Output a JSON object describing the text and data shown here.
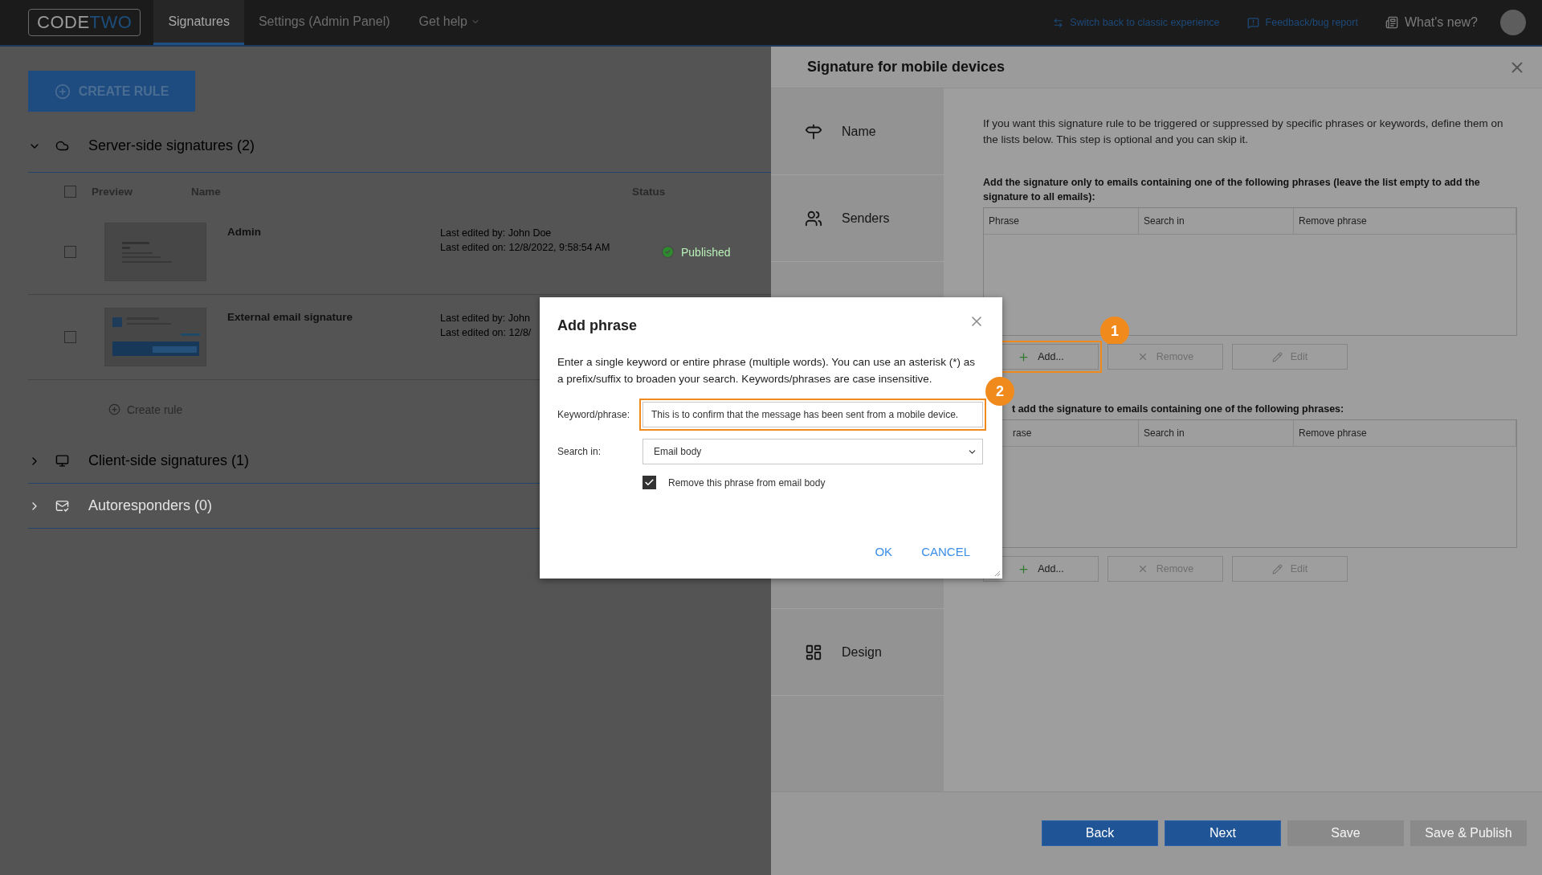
{
  "top_bar": {
    "logo": [
      "CODE",
      "TWO"
    ],
    "nav": [
      {
        "label": "Signatures",
        "selected": true,
        "has_menu": false
      },
      {
        "label": "Settings (Admin Panel)",
        "selected": false,
        "has_menu": false
      },
      {
        "label": "Get help",
        "selected": false,
        "has_menu": true
      }
    ],
    "links": [
      {
        "label": "Switch back to classic experience",
        "kind": "switch"
      },
      {
        "label": "Feedback/bug report",
        "kind": "feedback"
      },
      {
        "label": "What's new?",
        "kind": "news"
      }
    ]
  },
  "page": {
    "create_button": "CREATE RULE",
    "sections": [
      {
        "title": "Server-side signatures (2)",
        "expanded": true,
        "disabled": false,
        "all_checked": false,
        "columns": [
          "Preview",
          "Name",
          "Status"
        ],
        "rows": [
          {
            "checked": false,
            "name": "Admin",
            "edited_by_label": "Last edited by:",
            "edited_by": "John Doe",
            "edited_on_label": "Last edited on:",
            "edited_on": "12/8/2022, 9:58:54 AM",
            "status": "Published"
          },
          {
            "checked": false,
            "name": "External email signature",
            "edited_by_label": "Last edited by:",
            "edited_by": "John",
            "edited_on_label": "Last edited on:",
            "edited_on": "12/8/"
          }
        ],
        "add_link": "Create rule"
      },
      {
        "title": "Client-side signatures (1)",
        "expanded": false,
        "disabled": false
      },
      {
        "title": "Autoresponders (0)",
        "expanded": false,
        "disabled": true
      }
    ]
  },
  "panel": {
    "title": "Signature for mobile devices",
    "steps": [
      {
        "label": "Name"
      },
      {
        "label": "Senders"
      },
      {
        "label": "Design"
      }
    ],
    "intro": "If you want this signature rule to be triggered or suppressed by specific phrases or keywords, define them on the lists below. This step is optional and you can skip it.",
    "lists": [
      {
        "label": "Add the signature only to emails containing one of the following phrases (leave the list empty to add the signature to all emails):",
        "covered": false,
        "columns": [
          "Phrase",
          "Search in",
          "Remove phrase"
        ],
        "buttons": [
          {
            "label": "Add...",
            "kind": "add",
            "disabled": false,
            "callout": "1"
          },
          {
            "label": "Remove",
            "kind": "remove",
            "disabled": true
          },
          {
            "label": "Edit",
            "kind": "edit",
            "disabled": true
          }
        ]
      },
      {
        "label": "t add the signature to emails containing one of the following phrases:",
        "covered": true,
        "columns": [
          "rase",
          "Search in",
          "Remove phrase"
        ],
        "buttons": [
          {
            "label": "Add...",
            "kind": "add",
            "disabled": false
          },
          {
            "label": "Remove",
            "kind": "remove",
            "disabled": true
          },
          {
            "label": "Edit",
            "kind": "edit",
            "disabled": true
          }
        ]
      }
    ],
    "footer": [
      {
        "label": "Back",
        "disabled": false
      },
      {
        "label": "Next",
        "disabled": false
      },
      {
        "label": "Save",
        "disabled": true
      },
      {
        "label": "Save & Publish",
        "disabled": true
      }
    ]
  },
  "dialog": {
    "title": "Add phrase",
    "description": "Enter a single keyword or entire phrase (multiple words). You can use an asterisk (*) as a prefix/suffix to broaden your search. Keywords/phrases are case insensitive.",
    "keyword": {
      "label": "Keyword/phrase:",
      "value": "This is to confirm that the message has been sent from a mobile device.",
      "callout": "2"
    },
    "search_in": {
      "label": "Search in:",
      "value": "Email body"
    },
    "remove_option": {
      "label": "Remove this phrase from email body",
      "checked": true
    },
    "actions": [
      "OK",
      "CANCEL"
    ]
  }
}
